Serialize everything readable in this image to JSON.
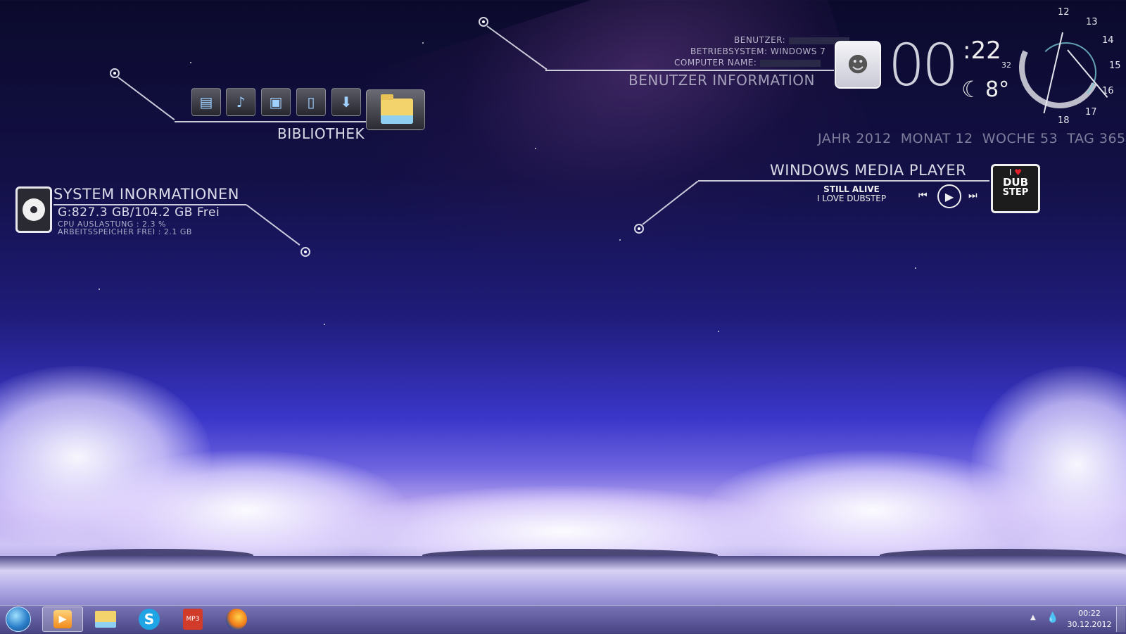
{
  "library": {
    "label": "BIBLIOTHEK",
    "icons": [
      "video-library-icon",
      "music-library-icon",
      "pictures-library-icon",
      "documents-library-icon",
      "downloads-icon",
      "folder-icon"
    ]
  },
  "system": {
    "title": "SYSTEM INORMATIONEN",
    "disk": "G:827.3 GB/104.2 GB Frei",
    "cpu": "CPU AUSLASTUNG : 2.3 %",
    "ram": "ARBEITSSPEICHER FREI : 2.1 GB"
  },
  "user": {
    "benutzer_label": "BENUTZER:",
    "os_label": "BETRIEBSYSTEM:",
    "os_value": "WINDOWS 7",
    "computer_label": "COMPUTER NAME:",
    "title": "BENUTZER INFORMATION"
  },
  "time": {
    "hours": "00",
    "minutes": ":22",
    "temperature": "8°",
    "weather_icon": "moon-cloud-icon",
    "date_line": "JAHR 2012  MONAT 12  WOCHE 53  TAG 365"
  },
  "clock": {
    "numbers": [
      "12",
      "13",
      "14",
      "15",
      "16",
      "17",
      "18",
      "32"
    ]
  },
  "media": {
    "title": "WINDOWS MEDIA PLAYER",
    "track": "STILL ALIVE",
    "artist": "I LOVE DUBSTEP",
    "art_text_1": "I",
    "art_text_2": "DUB",
    "art_text_3": "STEP"
  },
  "taskbar": {
    "apps": [
      "windows-media-player-icon",
      "file-explorer-icon",
      "skype-icon",
      "mp3-player-icon",
      "firefox-icon"
    ],
    "time": "00:22",
    "date": "30.12.2012"
  }
}
